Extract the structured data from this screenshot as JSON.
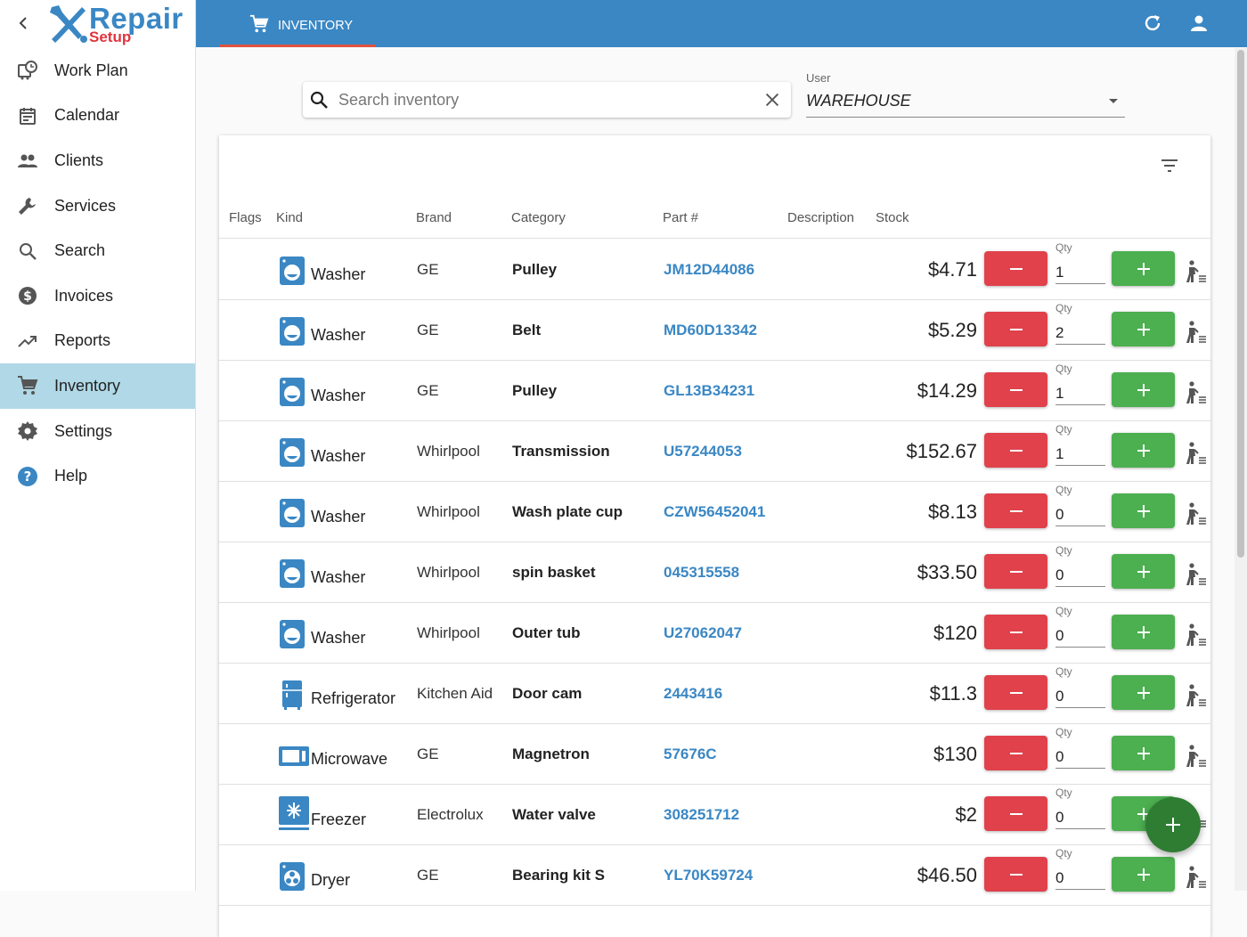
{
  "app": {
    "logo_word": "Repair",
    "logo_sub": "Setup"
  },
  "sidebar": {
    "items": [
      {
        "label": "Work Plan",
        "icon": "work-plan-icon"
      },
      {
        "label": "Calendar",
        "icon": "calendar-icon"
      },
      {
        "label": "Clients",
        "icon": "clients-icon"
      },
      {
        "label": "Services",
        "icon": "wrench-icon"
      },
      {
        "label": "Search",
        "icon": "search-icon"
      },
      {
        "label": "Invoices",
        "icon": "dollar-icon"
      },
      {
        "label": "Reports",
        "icon": "trending-up-icon"
      },
      {
        "label": "Inventory",
        "icon": "cart-icon",
        "active": true
      },
      {
        "label": "Settings",
        "icon": "gear-icon"
      },
      {
        "label": "Help",
        "icon": "help-icon"
      }
    ]
  },
  "topbar": {
    "tab_label": "INVENTORY"
  },
  "search": {
    "placeholder": "Search inventory",
    "value": ""
  },
  "user_filter": {
    "label": "User",
    "value": "WAREHOUSE"
  },
  "table": {
    "headers": [
      "Flags",
      "Kind",
      "Brand",
      "Category",
      "Part #",
      "Description",
      "Stock"
    ],
    "qty_label": "Qty",
    "rows": [
      {
        "kind": "Washer",
        "brand": "GE",
        "category": "Pulley",
        "part": "JM12D44086",
        "price": "$4.71",
        "qty": "1"
      },
      {
        "kind": "Washer",
        "brand": "GE",
        "category": "Belt",
        "part": "MD60D13342",
        "price": "$5.29",
        "qty": "2"
      },
      {
        "kind": "Washer",
        "brand": "GE",
        "category": "Pulley",
        "part": "GL13B34231",
        "price": "$14.29",
        "qty": "1"
      },
      {
        "kind": "Washer",
        "brand": "Whirlpool",
        "category": "Transmission",
        "part": "U57244053",
        "price": "$152.67",
        "qty": "1"
      },
      {
        "kind": "Washer",
        "brand": "Whirlpool",
        "category": "Wash plate cup",
        "part": "CZW56452041",
        "price": "$8.13",
        "qty": "0"
      },
      {
        "kind": "Washer",
        "brand": "Whirlpool",
        "category": "spin basket",
        "part": "045315558",
        "price": "$33.50",
        "qty": "0"
      },
      {
        "kind": "Washer",
        "brand": "Whirlpool",
        "category": "Outer tub",
        "part": "U27062047",
        "price": "$120",
        "qty": "0"
      },
      {
        "kind": "Refrigerator",
        "brand": "Kitchen Aid",
        "category": "Door cam",
        "part": "2443416",
        "price": "$11.3",
        "qty": "0"
      },
      {
        "kind": "Microwave",
        "brand": "GE",
        "category": "Magnetron",
        "part": "57676C",
        "price": "$130",
        "qty": "0"
      },
      {
        "kind": "Freezer",
        "brand": "Electrolux",
        "category": "Water valve",
        "part": "308251712",
        "price": "$2",
        "qty": "0"
      },
      {
        "kind": "Dryer",
        "brand": "GE",
        "category": "Bearing kit S",
        "part": "YL70K59724",
        "price": "$46.50",
        "qty": "0"
      }
    ]
  },
  "colors": {
    "accent": "#3a87c4",
    "active_nav": "#b0d8e6",
    "minus": "#e0414b",
    "plus": "#4caf50",
    "fab": "#2e7d32"
  }
}
